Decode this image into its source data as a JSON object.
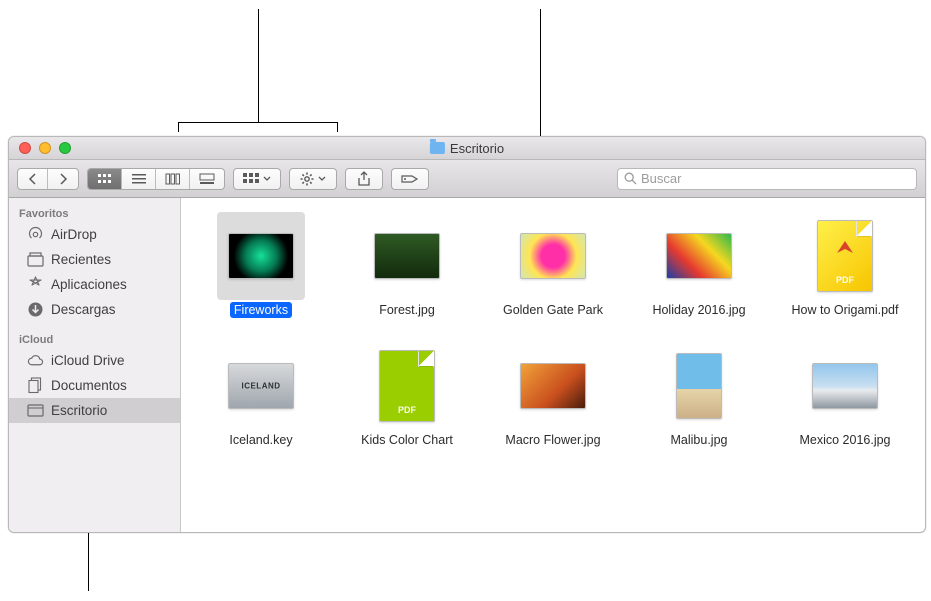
{
  "window_title": "Escritorio",
  "search_placeholder": "Buscar",
  "sidebar": {
    "section_favorites": "Favoritos",
    "section_icloud": "iCloud",
    "airdrop": "AirDrop",
    "recents": "Recientes",
    "apps": "Aplicaciones",
    "downloads": "Descargas",
    "icloud_drive": "iCloud Drive",
    "documents": "Documentos",
    "desktop": "Escritorio"
  },
  "files": {
    "f0": "Fireworks",
    "f1": "Forest.jpg",
    "f2": "Golden Gate Park",
    "f3": "Holiday 2016.jpg",
    "f4": "How to Origami.pdf",
    "f5": "Iceland.key",
    "f6": "Kids Color Chart",
    "f7": "Macro Flower.jpg",
    "f8": "Malibu.jpg",
    "f9": "Mexico 2016.jpg"
  }
}
